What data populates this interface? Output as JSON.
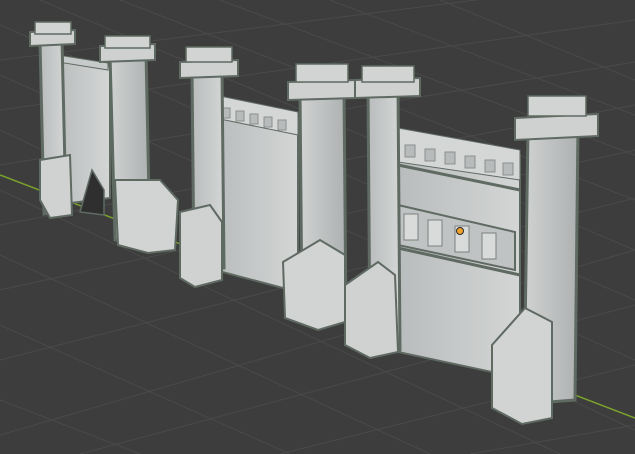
{
  "viewport": {
    "view": "3D Viewport",
    "background_color": "#3d3d3d",
    "grid_line_color": "#4a4a4a",
    "x_axis_color": "#7aa22b",
    "stone_color": "#c9cbcb",
    "trim_color": "#5f6a62",
    "origin_color": "#f0a32a"
  },
  "objects": [
    {
      "name": "gate-arch"
    },
    {
      "name": "wall-plain"
    },
    {
      "name": "wall-windows",
      "selected_origin": true
    }
  ]
}
